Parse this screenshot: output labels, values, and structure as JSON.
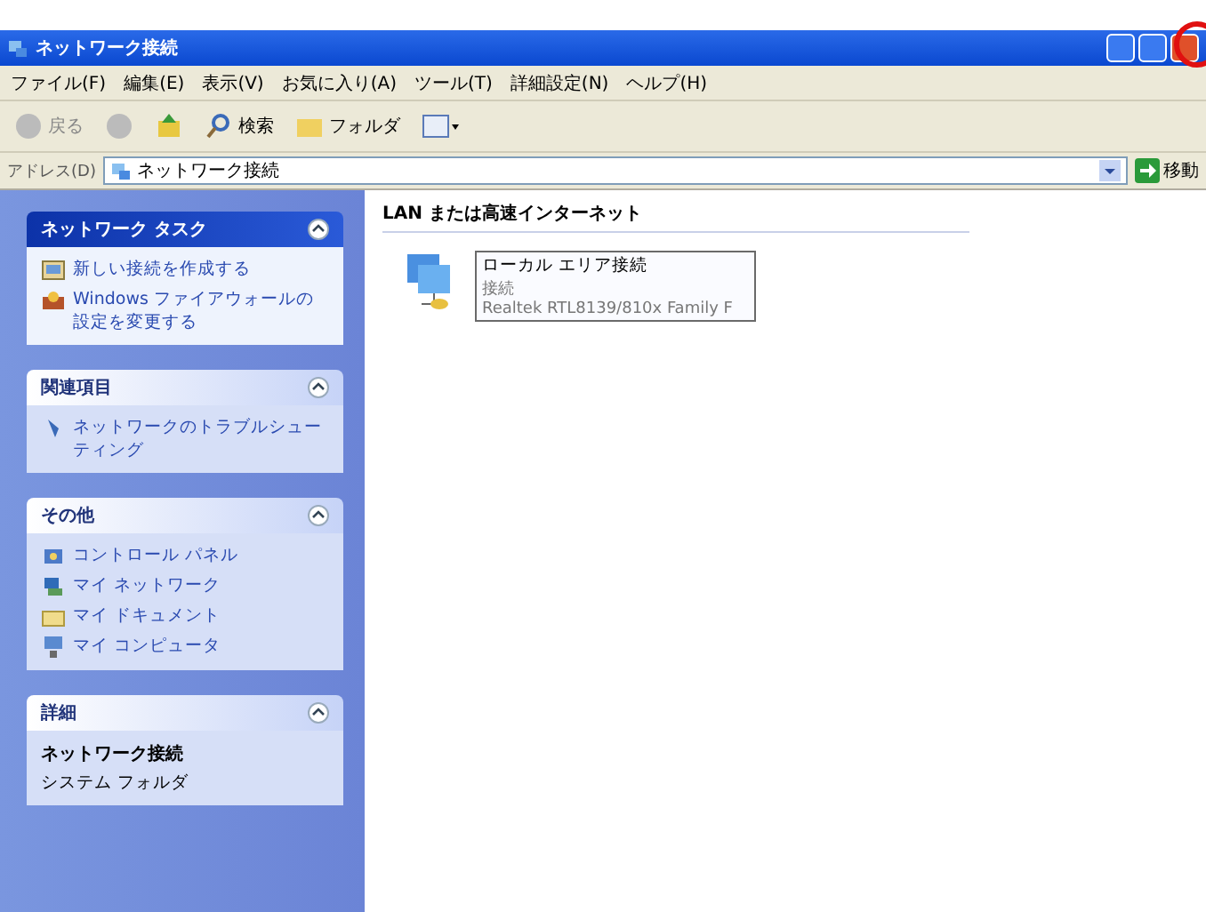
{
  "window": {
    "title": "ネットワーク接続"
  },
  "menu": [
    "ファイル(F)",
    "編集(E)",
    "表示(V)",
    "お気に入り(A)",
    "ツール(T)",
    "詳細設定(N)",
    "ヘルプ(H)"
  ],
  "toolbar": {
    "back": "戻る",
    "search": "検索",
    "folders": "フォルダ"
  },
  "address": {
    "label": "アドレス(D)",
    "value": "ネットワーク接続",
    "go": "移動"
  },
  "sidebar": [
    {
      "title": "ネットワーク タスク",
      "kind": "primary",
      "expanded": true,
      "items": [
        {
          "label": "新しい接続を作成する",
          "kind": "wizard"
        },
        {
          "label": "Windows ファイアウォールの設定を変更する",
          "kind": "firewall"
        }
      ]
    },
    {
      "title": "関連項目",
      "kind": "normal",
      "expanded": true,
      "items": [
        {
          "label": "ネットワークのトラブルシューティング",
          "kind": "help"
        }
      ]
    },
    {
      "title": "その他",
      "kind": "normal",
      "expanded": true,
      "items": [
        {
          "label": "コントロール パネル",
          "kind": "control"
        },
        {
          "label": "マイ ネットワーク",
          "kind": "network"
        },
        {
          "label": "マイ ドキュメント",
          "kind": "documents"
        },
        {
          "label": "マイ コンピュータ",
          "kind": "computer"
        }
      ]
    },
    {
      "title": "詳細",
      "kind": "details",
      "expanded": true,
      "name": "ネットワーク接続",
      "subtitle": "システム フォルダ"
    }
  ],
  "group": {
    "heading": "LAN または高速インターネット",
    "connections": [
      {
        "name": "ローカル エリア接続",
        "status": "接続",
        "device": "Realtek RTL8139/810x Family F",
        "selected": true
      }
    ]
  }
}
